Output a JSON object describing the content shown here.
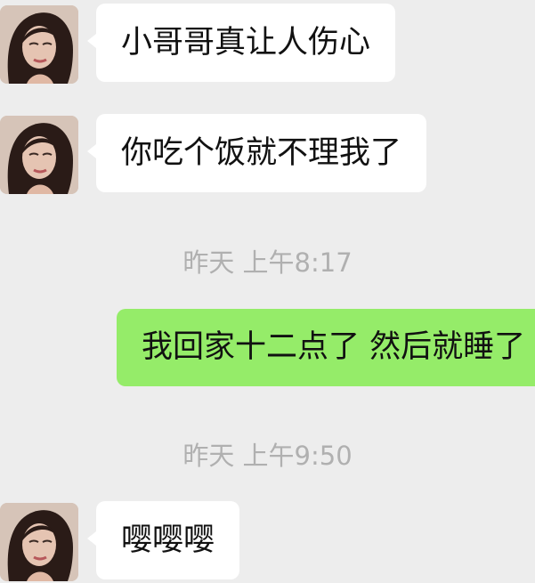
{
  "messages": [
    {
      "type": "incoming",
      "text": "小哥哥真让人伤心"
    },
    {
      "type": "incoming",
      "text": "你吃个饭就不理我了"
    },
    {
      "type": "timestamp",
      "text": "昨天 上午8:17"
    },
    {
      "type": "outgoing",
      "text": "我回家十二点了 然后就睡了"
    },
    {
      "type": "timestamp",
      "text": "昨天 上午9:50"
    },
    {
      "type": "incoming",
      "text": "嘤嘤嘤"
    }
  ]
}
